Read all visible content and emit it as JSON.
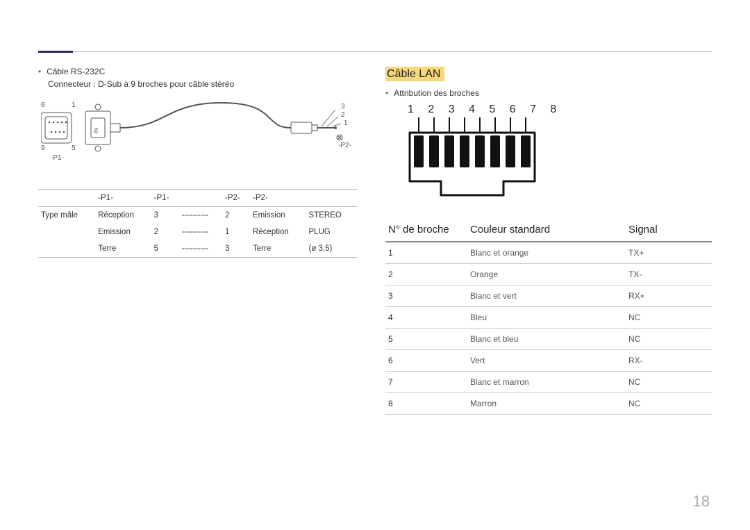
{
  "page_number": "18",
  "rs232": {
    "bullet": "Câble RS-232C",
    "sub": "Connecteur : D-Sub à 9 broches pour câble stéréo",
    "diagram": {
      "pin_tl": "6",
      "pin_tr": "1",
      "pin_bl": "9",
      "pin_br": "5",
      "p1_label": "-P1-",
      "plug_3": "3",
      "plug_2": "2",
      "plug_1": "1",
      "p2_label": "-P2-"
    },
    "head": {
      "p1a": "-P1-",
      "p1b": "-P1-",
      "p2a": "-P2-",
      "p2b": "-P2-"
    },
    "rows": [
      {
        "c0": "Type mâle",
        "c1": "Réception",
        "c2": "3",
        "c3": "----------",
        "c4": "2",
        "c5": "Emission",
        "c6": "STEREO"
      },
      {
        "c0": "",
        "c1": "Emission",
        "c2": "2",
        "c3": "----------",
        "c4": "1",
        "c5": "Réception",
        "c6": "PLUG"
      },
      {
        "c0": "",
        "c1": "Terre",
        "c2": "5",
        "c3": "----------",
        "c4": "3",
        "c5": "Terre",
        "c6": "(ø 3,5)"
      }
    ]
  },
  "lan": {
    "heading": "Câble LAN",
    "bullet": "Attribution des broches",
    "numbers": "1 2 3 4 5 6 7 8",
    "head": {
      "pin": "N° de broche",
      "color": "Couleur standard",
      "signal": "Signal"
    },
    "rows": [
      {
        "pin": "1",
        "color": "Blanc et orange",
        "signal": "TX+"
      },
      {
        "pin": "2",
        "color": "Orange",
        "signal": "TX-"
      },
      {
        "pin": "3",
        "color": "Blanc et vert",
        "signal": "RX+"
      },
      {
        "pin": "4",
        "color": "Bleu",
        "signal": "NC"
      },
      {
        "pin": "5",
        "color": "Blanc et bleu",
        "signal": "NC"
      },
      {
        "pin": "6",
        "color": "Vert",
        "signal": "RX-"
      },
      {
        "pin": "7",
        "color": "Blanc et marron",
        "signal": "NC"
      },
      {
        "pin": "8",
        "color": "Marron",
        "signal": "NC"
      }
    ]
  }
}
